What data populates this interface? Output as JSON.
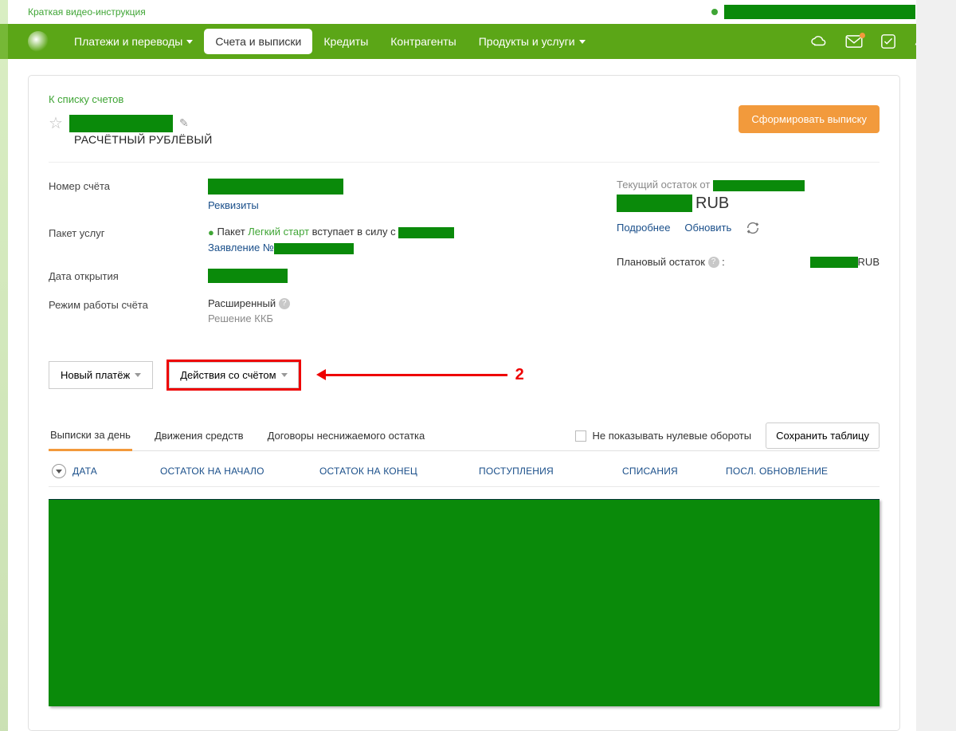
{
  "top": {
    "video_link": "Краткая видео-инструкция"
  },
  "nav": {
    "items": [
      "Платежи и переводы",
      "Счета и выписки",
      "Кредиты",
      "Контрагенты",
      "Продукты и услуги"
    ]
  },
  "page": {
    "back": "К списку счетов",
    "subtitle": "РАСЧЁТНЫЙ РУБЛЁВЫЙ",
    "generate_btn": "Сформировать выписку"
  },
  "details": {
    "acct_no_label": "Номер счёта",
    "requisites": "Реквизиты",
    "pkg_label": "Пакет услуг",
    "pkg_prefix": "Пакет ",
    "pkg_name": "Легкий старт",
    "pkg_suffix": " вступает в силу с ",
    "app_label": "Заявление №",
    "open_label": "Дата открытия",
    "mode_label": "Режим работы счёта",
    "mode_value": "Расширенный",
    "kkb": "Решение ККБ"
  },
  "balance": {
    "head": "Текущий остаток от ",
    "currency": "RUB",
    "more": "Подробнее",
    "refresh": "Обновить",
    "planned_label": "Плановый остаток",
    "planned_cur": "RUB"
  },
  "actions": {
    "new_payment": "Новый платёж",
    "acct_actions": "Действия со счётом"
  },
  "annotation": {
    "num": "2"
  },
  "tabs": {
    "t1": "Выписки за день",
    "t2": "Движения средств",
    "t3": "Договоры неснижаемого остатка",
    "hide_zero": "Не показывать нулевые обороты",
    "save": "Сохранить таблицу"
  },
  "thead": {
    "date": "ДАТА",
    "start": "ОСТАТОК НА НАЧАЛО",
    "end": "ОСТАТОК НА КОНЕЦ",
    "in": "ПОСТУПЛЕНИЯ",
    "out": "СПИСАНИЯ",
    "upd": "ПОСЛ. ОБНОВЛЕНИЕ"
  }
}
